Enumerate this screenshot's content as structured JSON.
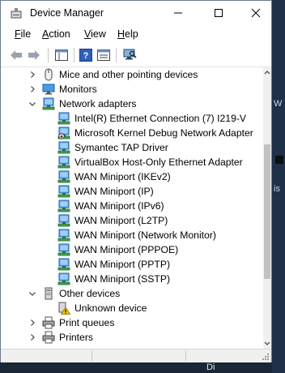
{
  "window": {
    "title": "Device Manager"
  },
  "menu": [
    {
      "key": "F",
      "rest": "ile"
    },
    {
      "key": "A",
      "rest": "ction"
    },
    {
      "key": "V",
      "rest": "iew"
    },
    {
      "key": "H",
      "rest": "elp"
    }
  ],
  "toolbar": [
    "back-arrow-icon",
    "forward-arrow-icon",
    "show-hide-console-tree-icon",
    "help-icon",
    "properties-icon",
    "scan-hardware-icon"
  ],
  "tree": [
    {
      "label": "Mice and other pointing devices",
      "level": 1,
      "state": "collapsed",
      "icon": "mouse-icon"
    },
    {
      "label": "Monitors",
      "level": 1,
      "state": "collapsed",
      "icon": "monitor-icon"
    },
    {
      "label": "Network adapters",
      "level": 1,
      "state": "expanded",
      "icon": "network-adapter-icon"
    },
    {
      "label": "Intel(R) Ethernet Connection (7) I219-V",
      "level": 2,
      "icon": "network-adapter-icon"
    },
    {
      "label": "Microsoft Kernel Debug Network Adapter",
      "level": 2,
      "icon": "network-adapter-disabled-icon"
    },
    {
      "label": "Symantec TAP Driver",
      "level": 2,
      "icon": "network-adapter-icon"
    },
    {
      "label": "VirtualBox Host-Only Ethernet Adapter",
      "level": 2,
      "icon": "network-adapter-icon"
    },
    {
      "label": "WAN Miniport (IKEv2)",
      "level": 2,
      "icon": "network-adapter-icon"
    },
    {
      "label": "WAN Miniport (IP)",
      "level": 2,
      "icon": "network-adapter-icon"
    },
    {
      "label": "WAN Miniport (IPv6)",
      "level": 2,
      "icon": "network-adapter-icon"
    },
    {
      "label": "WAN Miniport (L2TP)",
      "level": 2,
      "icon": "network-adapter-icon"
    },
    {
      "label": "WAN Miniport (Network Monitor)",
      "level": 2,
      "icon": "network-adapter-icon"
    },
    {
      "label": "WAN Miniport (PPPOE)",
      "level": 2,
      "icon": "network-adapter-icon"
    },
    {
      "label": "WAN Miniport (PPTP)",
      "level": 2,
      "icon": "network-adapter-icon"
    },
    {
      "label": "WAN Miniport (SSTP)",
      "level": 2,
      "icon": "network-adapter-icon"
    },
    {
      "label": "Other devices",
      "level": 1,
      "state": "expanded",
      "icon": "other-devices-icon"
    },
    {
      "label": "Unknown device",
      "level": 2,
      "icon": "unknown-device-warning-icon"
    },
    {
      "label": "Print queues",
      "level": 1,
      "state": "collapsed",
      "icon": "printer-icon"
    },
    {
      "label": "Printers",
      "level": 1,
      "state": "collapsed",
      "icon": "printer-icon"
    }
  ],
  "background": {
    "right_glyph_1": "W",
    "right_glyph_2": "is",
    "bottom_text": "Di"
  }
}
